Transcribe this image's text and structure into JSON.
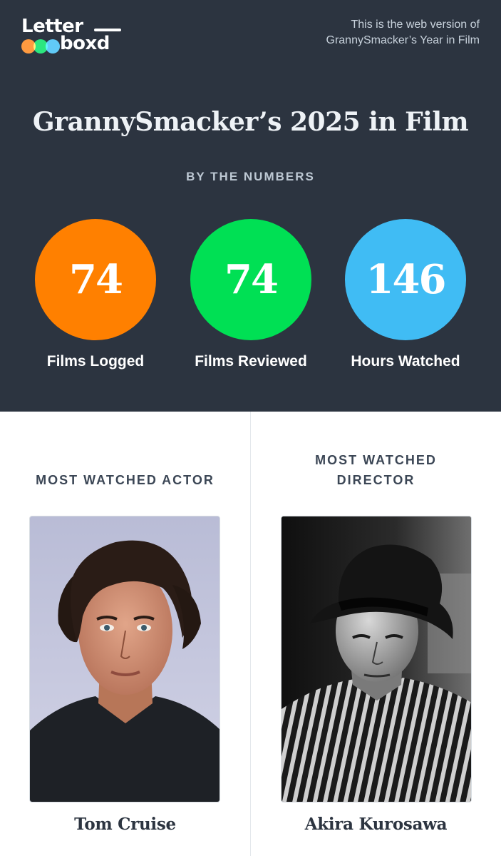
{
  "brand": {
    "logo_line1": "Letter",
    "logo_line2": "boxd",
    "dot_colors": [
      "#ff8000",
      "#00e054",
      "#40bcf4"
    ]
  },
  "web_note": {
    "line1": "This is the web version of",
    "line2": "GrannySmacker’s Year in Film"
  },
  "title": "GrannySmacker’s 2025 in Film",
  "numbers_heading": "BY THE NUMBERS",
  "stats": [
    {
      "value": "74",
      "label": "Films Logged",
      "color": "#ff8000"
    },
    {
      "value": "74",
      "label": "Films Reviewed",
      "color": "#00e054"
    },
    {
      "value": "146",
      "label": "Hours Watched",
      "color": "#40bcf4"
    }
  ],
  "most_watched": {
    "actor": {
      "heading": "MOST WATCHED ACTOR",
      "name": "Tom Cruise"
    },
    "director": {
      "heading_line1": "MOST WATCHED",
      "heading_line2": "DIRECTOR",
      "name": "Akira Kurosawa"
    }
  },
  "colors": {
    "header_bg": "#2c3440",
    "page_bg": "#ffffff"
  }
}
